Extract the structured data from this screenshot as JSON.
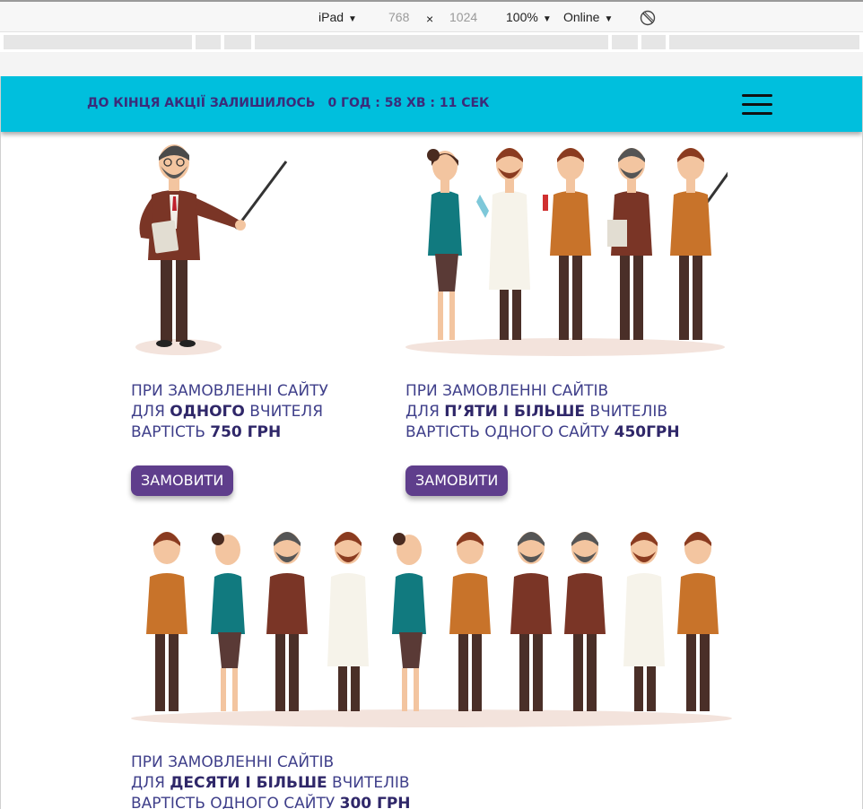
{
  "device_toolbar": {
    "device": "iPad",
    "width": "768",
    "times": "×",
    "height": "1024",
    "zoom": "100%",
    "network": "Online",
    "caret": "▼"
  },
  "promo": {
    "label": "ДО КІНЦЯ АКЦІЇ ЗАЛИШИЛОСЬ",
    "timer": "0 ГОД : 58 ХВ : 11 СЕК"
  },
  "offers": [
    {
      "line1": "ПРИ ЗАМОВЛЕННІ САЙТУ",
      "line2_prefix": "ДЛЯ ",
      "line2_bold": "ОДНОГО",
      "line2_suffix": " ВЧИТЕЛЯ",
      "line3_prefix": "ВАРТІСТЬ ",
      "line3_bold": "750 ГРН",
      "button": "ЗАМОВИТИ"
    },
    {
      "line1": "ПРИ ЗАМОВЛЕННІ САЙТІВ",
      "line2_prefix": "ДЛЯ ",
      "line2_bold": "П’ЯТИ І БІЛЬШЕ",
      "line2_suffix": " ВЧИТЕЛІВ",
      "line3_prefix": "ВАРТІСТЬ ОДНОГО САЙТУ ",
      "line3_bold": "450ГРН",
      "button": "ЗАМОВИТИ"
    },
    {
      "line1": "ПРИ ЗАМОВЛЕННІ САЙТІВ",
      "line2_prefix": "ДЛЯ ",
      "line2_bold": "ДЕСЯТИ І БІЛЬШЕ",
      "line2_suffix": " ВЧИТЕЛІВ",
      "line3_prefix": "ВАРТІСТЬ ОДНОГО САЙТУ ",
      "line3_bold": "300 ГРН"
    }
  ],
  "colors": {
    "promo_bar": "#00bfdd",
    "promo_text": "#3b2c7a",
    "button": "#5f3e8c",
    "offer_text": "#3f3f8a"
  },
  "illustrations": {
    "group1": [
      "teacher-with-pointer"
    ],
    "group2": [
      "teacher-woman",
      "scientist-with-flask",
      "teacher-with-test-tube",
      "teacher-with-book",
      "teacher-with-pointer"
    ],
    "group3": [
      "teacher-with-test-tube",
      "teacher-woman",
      "teacher-with-plant",
      "scientist-with-flask",
      "teacher-woman",
      "teacher-with-test-tube",
      "teacher-with-book",
      "teacher-with-book",
      "scientist-with-flask",
      "teacher-with-test-tube"
    ]
  }
}
